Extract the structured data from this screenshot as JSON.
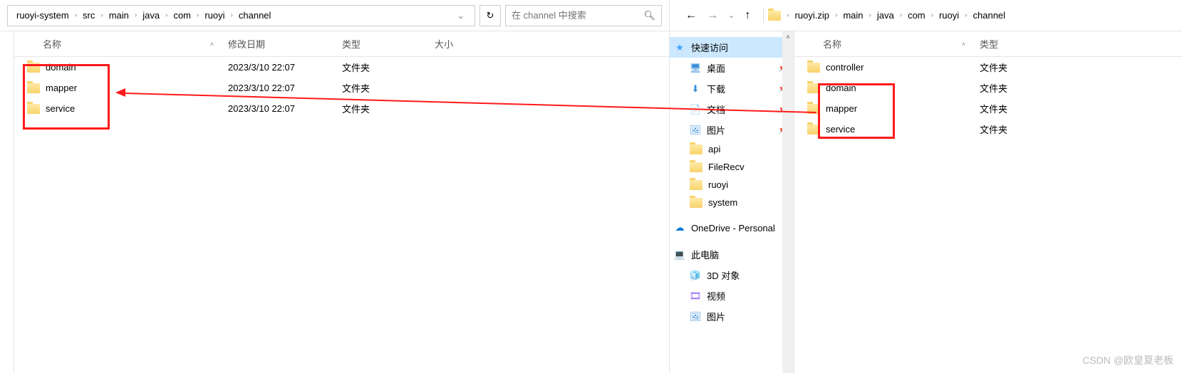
{
  "left": {
    "breadcrumb": [
      "ruoyi-system",
      "src",
      "main",
      "java",
      "com",
      "ruoyi",
      "channel"
    ],
    "search_placeholder": "在 channel 中搜索",
    "columns": {
      "name": "名称",
      "date": "修改日期",
      "type": "类型",
      "size": "大小"
    },
    "rows": [
      {
        "name": "domain",
        "date": "2023/3/10 22:07",
        "type": "文件夹"
      },
      {
        "name": "mapper",
        "date": "2023/3/10 22:07",
        "type": "文件夹"
      },
      {
        "name": "service",
        "date": "2023/3/10 22:07",
        "type": "文件夹"
      }
    ]
  },
  "right": {
    "breadcrumb": [
      "ruoyi.zip",
      "main",
      "java",
      "com",
      "ruoyi",
      "channel"
    ],
    "columns": {
      "name": "名称",
      "type": "类型"
    },
    "rows": [
      {
        "name": "controller",
        "type": "文件夹"
      },
      {
        "name": "domain",
        "type": "文件夹"
      },
      {
        "name": "mapper",
        "type": "文件夹"
      },
      {
        "name": "service",
        "type": "文件夹"
      }
    ],
    "sidebar": {
      "quick_access": "快速访问",
      "items": [
        {
          "label": "桌面",
          "icon": "desk",
          "pin": true
        },
        {
          "label": "下载",
          "icon": "down",
          "pin": true
        },
        {
          "label": "文档",
          "icon": "doc",
          "pin": true
        },
        {
          "label": "图片",
          "icon": "pic",
          "pin": true
        },
        {
          "label": "api",
          "icon": "folder"
        },
        {
          "label": "FileRecv",
          "icon": "folder"
        },
        {
          "label": "ruoyi",
          "icon": "folder"
        },
        {
          "label": "system",
          "icon": "folder"
        }
      ],
      "onedrive": "OneDrive - Personal",
      "this_pc": "此电脑",
      "pc_items": [
        {
          "label": "3D 对象",
          "icon": "cube"
        },
        {
          "label": "视频",
          "icon": "vid"
        },
        {
          "label": "图片",
          "icon": "pic"
        }
      ]
    }
  },
  "watermark": "CSDN @欧皇夏老板"
}
